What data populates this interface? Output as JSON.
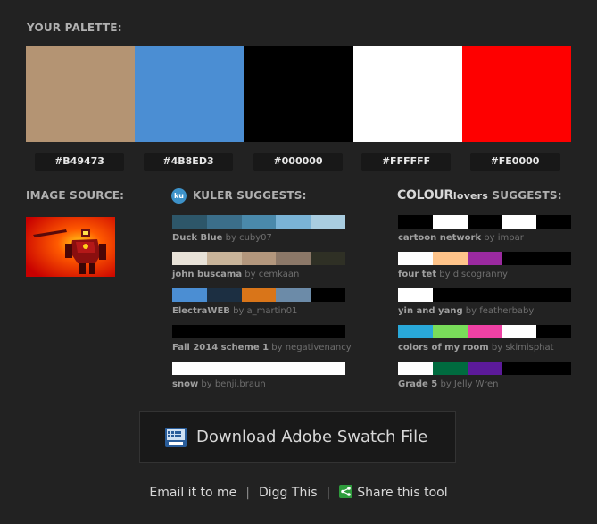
{
  "palette": {
    "heading": "YOUR PALETTE:",
    "colors": [
      {
        "hex": "#B49473",
        "label": "#B49473"
      },
      {
        "hex": "#4B8ED3",
        "label": "#4B8ED3"
      },
      {
        "hex": "#000000",
        "label": "#000000"
      },
      {
        "hex": "#FFFFFF",
        "label": "#FFFFFF"
      },
      {
        "hex": "#FE0000",
        "label": "#FE0000"
      }
    ]
  },
  "image_source": {
    "heading": "IMAGE SOURCE:"
  },
  "kuler": {
    "logo_text": "ku",
    "heading": "KULER SUGGESTS:",
    "items": [
      {
        "name": "Duck Blue",
        "by": "by cuby07",
        "colors": [
          "#2d5669",
          "#3b6e8a",
          "#4a89ab",
          "#7ab3d6",
          "#a9cde0"
        ]
      },
      {
        "name": "john buscama",
        "by": "by cemkaan",
        "colors": [
          "#e8e2d8",
          "#c9b49a",
          "#b3977d",
          "#8c7868",
          "#2f3025"
        ]
      },
      {
        "name": "ElectraWEB",
        "by": "by a_martin01",
        "colors": [
          "#4b8ed3",
          "#1c2f42",
          "#d97519",
          "#6c8ba8",
          "#000000"
        ]
      },
      {
        "name": "Fall 2014 scheme 1",
        "by": "by negativenancy",
        "colors": [
          "#000000",
          "#000000",
          "#000000",
          "#000000",
          "#000000"
        ]
      },
      {
        "name": "snow",
        "by": "by benji.braun",
        "colors": [
          "#ffffff",
          "#ffffff",
          "#ffffff",
          "#ffffff",
          "#ffffff"
        ]
      }
    ]
  },
  "colourlovers": {
    "heading_brand_a": "COLOUR",
    "heading_brand_b": "lovers",
    "heading_rest": " SUGGESTS:",
    "items": [
      {
        "name": "cartoon network",
        "by": "by impar",
        "colors": [
          "#000000",
          "#ffffff",
          "#000000",
          "#ffffff",
          "#000000"
        ]
      },
      {
        "name": "four tet",
        "by": "by discogranny",
        "colors": [
          "#ffffff",
          "#ffc48a",
          "#9b2aa0",
          "#000000",
          "#000000"
        ]
      },
      {
        "name": "yin and yang",
        "by": "by featherbaby",
        "colors": [
          "#ffffff",
          "#000000",
          "#000000",
          "#000000",
          "#000000"
        ]
      },
      {
        "name": "colors of my room",
        "by": "by skimisphat",
        "colors": [
          "#29a8d9",
          "#79dc5a",
          "#ee41a4",
          "#ffffff",
          "#000000"
        ]
      },
      {
        "name": "Grade 5",
        "by": "by Jelly Wren",
        "colors": [
          "#ffffff",
          "#006b3f",
          "#5c1a9a",
          "#000000",
          "#000000"
        ]
      }
    ]
  },
  "download": {
    "label": "Download Adobe Swatch File",
    "icon": "swatch-file-icon"
  },
  "footer": {
    "email": "Email it to me",
    "sep1": "|",
    "digg": "Digg This",
    "sep2": "|",
    "share": "Share this tool",
    "share_icon": "share-icon"
  }
}
